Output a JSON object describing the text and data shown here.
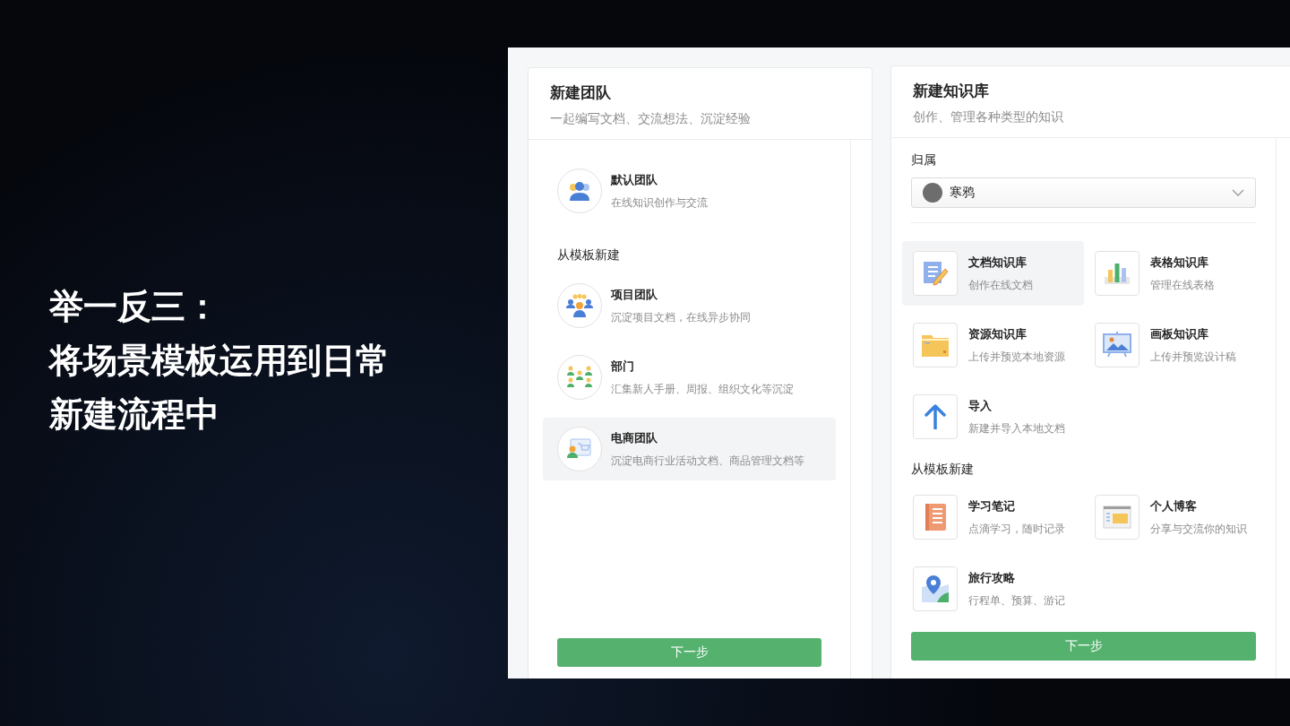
{
  "slide": {
    "headline_lines": [
      "举一反三：",
      "将场景模板运用到日常",
      "新建流程中"
    ]
  },
  "team_dialog": {
    "title": "新建团队",
    "subtitle": "一起编写文档、交流想法、沉淀经验",
    "default_item": {
      "name": "默认团队",
      "description": "在线知识创作与交流",
      "selected": false
    },
    "template_heading": "从模板新建",
    "templates": [
      {
        "name": "项目团队",
        "description": "沉淀项目文档，在线异步协同",
        "selected": false
      },
      {
        "name": "部门",
        "description": "汇集新人手册、周报、组织文化等沉淀",
        "selected": false
      },
      {
        "name": "电商团队",
        "description": "沉淀电商行业活动文档、商品管理文档等",
        "selected": true
      }
    ],
    "next_button": "下一步"
  },
  "kb_dialog": {
    "title": "新建知识库",
    "subtitle": "创作、管理各种类型的知识",
    "owner_label": "归属",
    "owner_value": "寒鸦",
    "types": [
      {
        "name": "文档知识库",
        "description": "创作在线文档",
        "selected": true
      },
      {
        "name": "表格知识库",
        "description": "管理在线表格",
        "selected": false
      },
      {
        "name": "资源知识库",
        "description": "上传并预览本地资源",
        "selected": false
      },
      {
        "name": "画板知识库",
        "description": "上传并预览设计稿",
        "selected": false
      },
      {
        "name": "导入",
        "description": "新建并导入本地文档",
        "selected": false
      }
    ],
    "template_heading": "从模板新建",
    "templates": [
      {
        "name": "学习笔记",
        "description": "点滴学习，随时记录",
        "selected": false
      },
      {
        "name": "个人博客",
        "description": "分享与交流你的知识",
        "selected": false
      },
      {
        "name": "旅行攻略",
        "description": "行程单、预算、游记",
        "selected": false
      }
    ],
    "next_button": "下一步"
  }
}
